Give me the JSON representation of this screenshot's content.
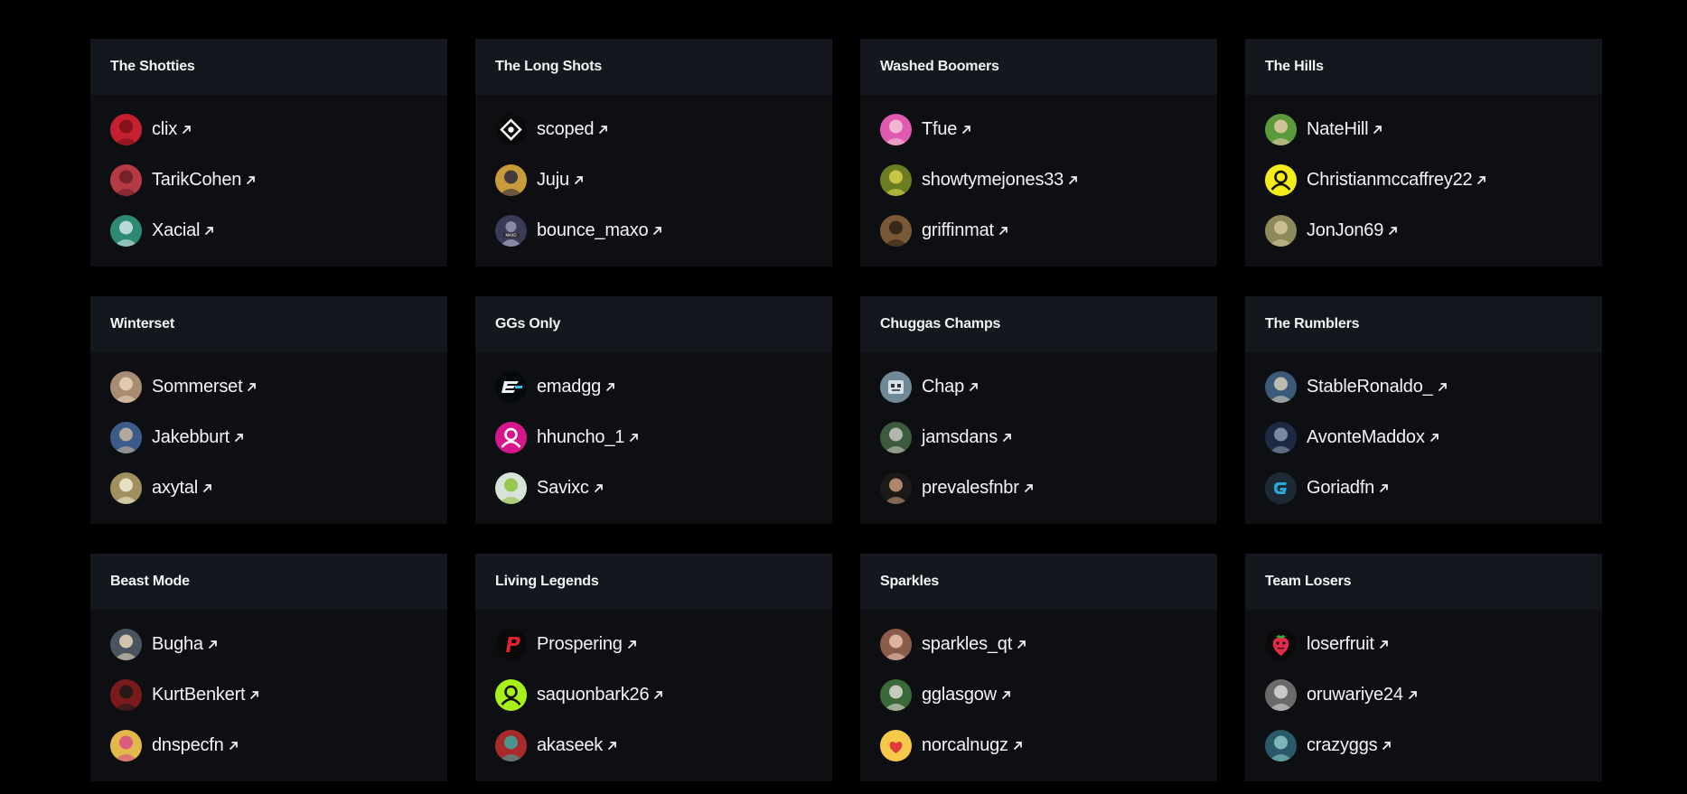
{
  "teams": [
    {
      "name": "The Shotties",
      "players": [
        {
          "name": "clix",
          "avatar": "person-icon",
          "color": "#c4202f",
          "color2": "#7a1018"
        },
        {
          "name": "TarikCohen",
          "avatar": "person-icon",
          "color": "#b63a44",
          "color2": "#6a1f25"
        },
        {
          "name": "Xacial",
          "avatar": "person-icon",
          "color": "#2c8a74",
          "color2": "#d5e3ea"
        }
      ]
    },
    {
      "name": "The Long Shots",
      "players": [
        {
          "name": "scoped",
          "avatar": "crosshair-logo-icon",
          "color": "#0a0a0a",
          "color2": "#ffffff"
        },
        {
          "name": "Juju",
          "avatar": "person-icon",
          "color": "#c89a3a",
          "color2": "#2a2a40"
        },
        {
          "name": "bounce_maxo",
          "avatar": "maxo-logo-icon",
          "color": "#3b3a55",
          "color2": "#8a86a8"
        }
      ]
    },
    {
      "name": "Washed Boomers",
      "players": [
        {
          "name": "Tfue",
          "avatar": "person-icon",
          "color": "#e05ab0",
          "color2": "#f3c7d7"
        },
        {
          "name": "showtymejones33",
          "avatar": "person-icon",
          "color": "#6b7d22",
          "color2": "#d8d24a"
        },
        {
          "name": "griffinmat",
          "avatar": "person-icon",
          "color": "#7a5a36",
          "color2": "#2a1e14"
        }
      ]
    },
    {
      "name": "The Hills",
      "players": [
        {
          "name": "NateHill",
          "avatar": "person-icon",
          "color": "#5b9a3a",
          "color2": "#e8c9a8"
        },
        {
          "name": "Christianmccaffrey22",
          "avatar": "default-user-icon",
          "color": "#f4ec1a",
          "color2": "#111111"
        },
        {
          "name": "JonJon69",
          "avatar": "person-icon",
          "color": "#8c8a5a",
          "color2": "#d4c79a"
        }
      ]
    },
    {
      "name": "Winterset",
      "players": [
        {
          "name": "Sommerset",
          "avatar": "person-icon",
          "color": "#a88d72",
          "color2": "#e9d3bd"
        },
        {
          "name": "Jakebburt",
          "avatar": "person-icon",
          "color": "#3c5a8a",
          "color2": "#c7b59a"
        },
        {
          "name": "axytal",
          "avatar": "person-icon",
          "color": "#a09060",
          "color2": "#f1eed2"
        }
      ]
    },
    {
      "name": "GGs Only",
      "players": [
        {
          "name": "emadgg",
          "avatar": "e-logo-icon",
          "color": "#05080c",
          "color2": "#2fc6e6"
        },
        {
          "name": "hhuncho_1",
          "avatar": "default-user-icon",
          "color": "#d6178c",
          "color2": "#ffffff"
        },
        {
          "name": "Savixc",
          "avatar": "person-icon",
          "color": "#d7e2d8",
          "color2": "#8dc23a"
        }
      ]
    },
    {
      "name": "Chuggas Champs",
      "players": [
        {
          "name": "Chap",
          "avatar": "robot-icon",
          "color": "#6f8a96",
          "color2": "#d2e2e8"
        },
        {
          "name": "jamsdans",
          "avatar": "person-icon",
          "color": "#3c5a3c",
          "color2": "#c9c7c2"
        },
        {
          "name": "prevalesfnbr",
          "avatar": "person-icon",
          "color": "#1c1a18",
          "color2": "#c79a7a"
        }
      ]
    },
    {
      "name": "The Rumblers",
      "players": [
        {
          "name": "StableRonaldo_",
          "avatar": "person-icon",
          "color": "#3a5a7a",
          "color2": "#d6cdb8"
        },
        {
          "name": "AvonteMaddox",
          "avatar": "person-icon",
          "color": "#1c2a44",
          "color2": "#8a9ab2"
        },
        {
          "name": "Goriadfn",
          "avatar": "g-logo-icon",
          "color": "#1c2a36",
          "color2": "#2aa8d8"
        }
      ]
    },
    {
      "name": "Beast Mode",
      "players": [
        {
          "name": "Bugha",
          "avatar": "person-icon",
          "color": "#4a5460",
          "color2": "#e8d8b8"
        },
        {
          "name": "KurtBenkert",
          "avatar": "person-icon",
          "color": "#7a1a1a",
          "color2": "#1a1a1a"
        },
        {
          "name": "dnspecfn",
          "avatar": "person-icon",
          "color": "#e2b84a",
          "color2": "#d84a8a"
        }
      ]
    },
    {
      "name": "Living Legends",
      "players": [
        {
          "name": "Prospering",
          "avatar": "p-logo-icon",
          "color": "#0a0a0a",
          "color2": "#e2212a"
        },
        {
          "name": "saquonbark26",
          "avatar": "default-user-icon",
          "color": "#a8f01a",
          "color2": "#111111"
        },
        {
          "name": "akaseek",
          "avatar": "person-icon",
          "color": "#a82a2a",
          "color2": "#3aa8a0"
        }
      ]
    },
    {
      "name": "Sparkles",
      "players": [
        {
          "name": "sparkles_qt",
          "avatar": "person-icon",
          "color": "#8a5a4a",
          "color2": "#e8c4b0"
        },
        {
          "name": "gglasgow",
          "avatar": "person-icon",
          "color": "#3a6a3a",
          "color2": "#e2dcd4"
        },
        {
          "name": "norcalnugz",
          "avatar": "heart-face-icon",
          "color": "#f7c94a",
          "color2": "#e23a3a"
        }
      ]
    },
    {
      "name": "Team Losers",
      "players": [
        {
          "name": "loserfruit",
          "avatar": "strawberry-icon",
          "color": "#0a0a0a",
          "color2": "#e22a4a"
        },
        {
          "name": "oruwariye24",
          "avatar": "person-icon",
          "color": "#6a6a6a",
          "color2": "#d8d8d8"
        },
        {
          "name": "crazyggs",
          "avatar": "person-icon",
          "color": "#2a5a6a",
          "color2": "#8ac8c8"
        }
      ]
    }
  ]
}
